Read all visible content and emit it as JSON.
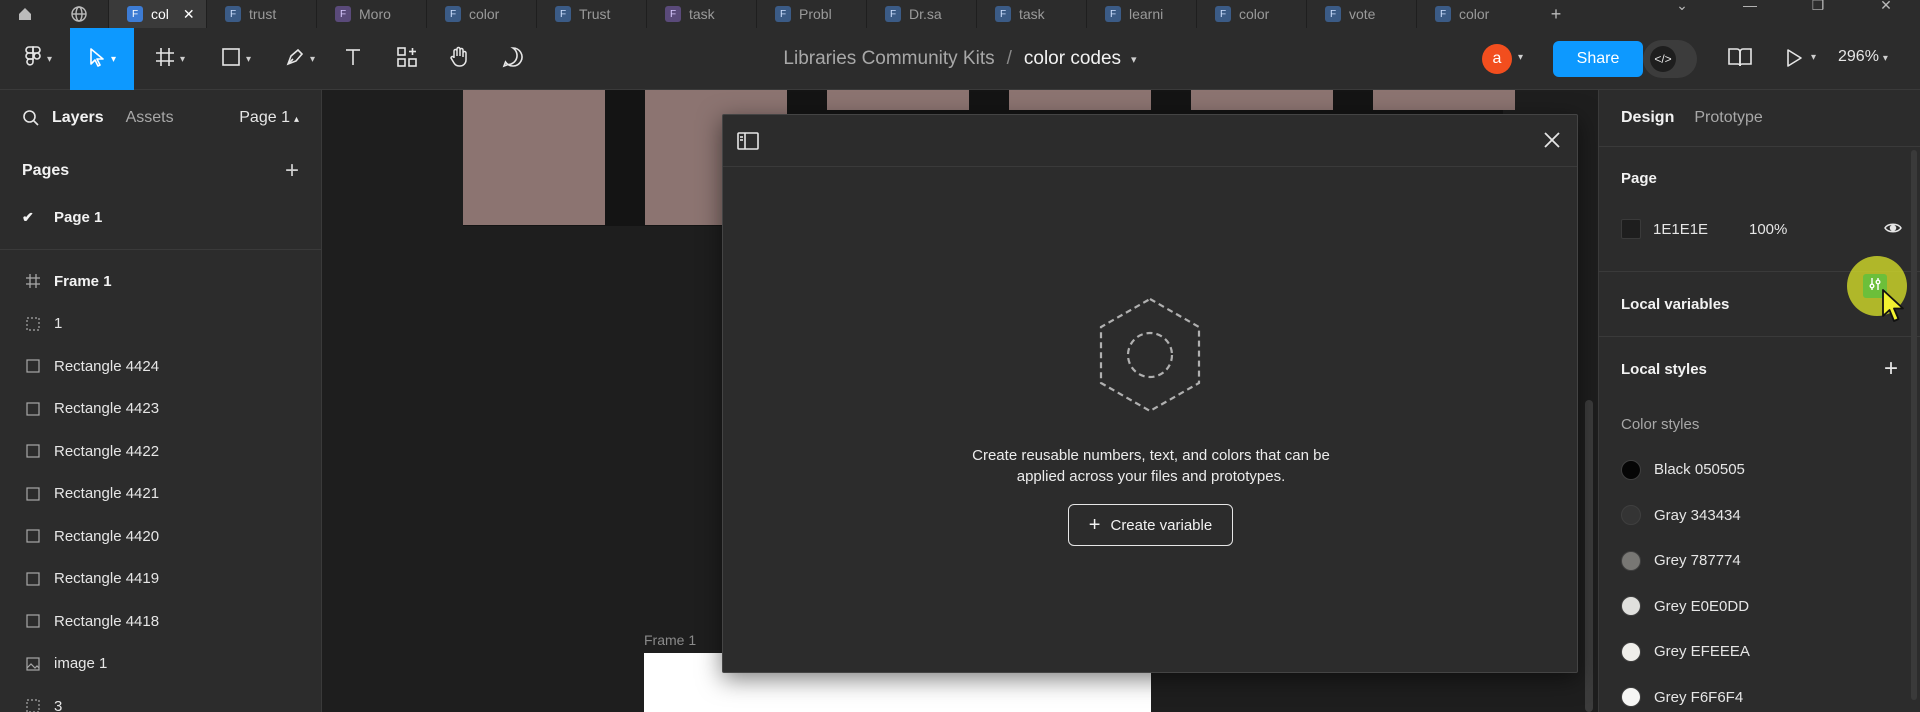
{
  "browser": {
    "tabs": [
      {
        "label": "col",
        "icon": "figma-icon",
        "active": true
      },
      {
        "label": "trust",
        "icon": "figma-icon"
      },
      {
        "label": "Moro",
        "icon": "figjam-icon"
      },
      {
        "label": "color",
        "icon": "figma-icon"
      },
      {
        "label": "Trust",
        "icon": "figma-icon"
      },
      {
        "label": "task",
        "icon": "figjam-icon"
      },
      {
        "label": "Probl",
        "icon": "figma-icon"
      },
      {
        "label": "Dr.sa",
        "icon": "figma-icon"
      },
      {
        "label": "task",
        "icon": "figma-icon"
      },
      {
        "label": "learni",
        "icon": "figma-icon"
      },
      {
        "label": "color",
        "icon": "figma-icon"
      },
      {
        "label": "vote",
        "icon": "figma-icon"
      },
      {
        "label": "color",
        "icon": "figma-icon"
      }
    ],
    "active_tab_close": "✕",
    "new_tab": "+"
  },
  "toolbar": {
    "tools": [
      "figma-menu-icon",
      "move-tool-icon",
      "frame-tool-icon",
      "shape-tool-icon",
      "pen-tool-icon",
      "text-tool-icon",
      "resources-icon",
      "hand-tool-icon",
      "comment-tool-icon"
    ],
    "active_tool": "move-tool-icon",
    "breadcrumb_project": "Libraries Community Kits",
    "breadcrumb_sep": "/",
    "file_name": "color codes",
    "avatar_letter": "a",
    "share_label": "Share",
    "zoom_label": "296%"
  },
  "left_panel": {
    "tab_layers": "Layers",
    "tab_assets": "Assets",
    "page_selector": "Page 1",
    "pages_title": "Pages",
    "pages": [
      {
        "name": "Page 1",
        "selected": true
      }
    ],
    "layers": [
      {
        "name": "Frame 1",
        "icon": "frame-icon",
        "bold": true
      },
      {
        "name": "1",
        "icon": "section-icon"
      },
      {
        "name": "Rectangle 4424",
        "icon": "rectangle-icon"
      },
      {
        "name": "Rectangle 4423",
        "icon": "rectangle-icon"
      },
      {
        "name": "Rectangle 4422",
        "icon": "rectangle-icon"
      },
      {
        "name": "Rectangle 4421",
        "icon": "rectangle-icon"
      },
      {
        "name": "Rectangle 4420",
        "icon": "rectangle-icon"
      },
      {
        "name": "Rectangle 4419",
        "icon": "rectangle-icon"
      },
      {
        "name": "Rectangle 4418",
        "icon": "rectangle-icon"
      },
      {
        "name": "image 1",
        "icon": "image-icon"
      },
      {
        "name": "3",
        "icon": "section-icon"
      }
    ]
  },
  "canvas": {
    "frame_label": "Frame 1",
    "swatch_color": "#8c7471"
  },
  "modal": {
    "message_line1": "Create reusable numbers, text, and colors that can be",
    "message_line2": "applied across your files and prototypes.",
    "create_button": "Create variable",
    "create_button_icon": "+"
  },
  "right_panel": {
    "tab_design": "Design",
    "tab_prototype": "Prototype",
    "page_section": "Page",
    "page_color": "1E1E1E",
    "page_opacity": "100%",
    "local_variables": "Local variables",
    "local_styles": "Local styles",
    "color_styles_title": "Color styles",
    "color_styles": [
      {
        "name": "Black 050505",
        "color": "#050505"
      },
      {
        "name": "Gray 343434",
        "color": "#343434"
      },
      {
        "name": "Grey 787774",
        "color": "#787774"
      },
      {
        "name": "Grey E0E0DD",
        "color": "#E0E0DD"
      },
      {
        "name": "Grey EFEEEA",
        "color": "#EFEEEA"
      },
      {
        "name": "Grey F6F6F4",
        "color": "#F6F6F4"
      }
    ]
  }
}
